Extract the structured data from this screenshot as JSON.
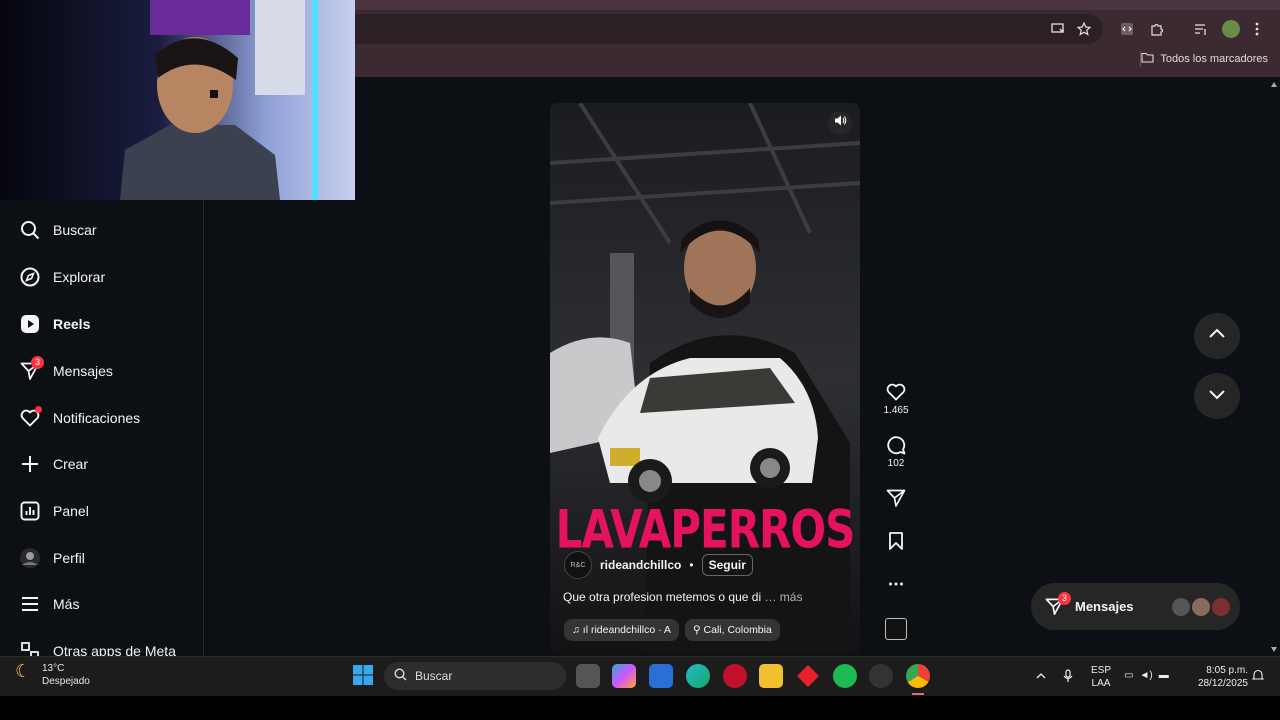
{
  "browser": {
    "bookmarks_label": "Todos los marcadores",
    "icons": [
      "install-icon",
      "star-icon",
      "devtools-icon",
      "extensions-icon",
      "reading-list-icon",
      "profile-icon",
      "menu-icon"
    ]
  },
  "sidebar": {
    "items": [
      {
        "label": "Buscar",
        "icon": "search-icon"
      },
      {
        "label": "Explorar",
        "icon": "compass-icon"
      },
      {
        "label": "Reels",
        "icon": "reels-icon"
      },
      {
        "label": "Mensajes",
        "icon": "send-icon",
        "badge": "3"
      },
      {
        "label": "Notificaciones",
        "icon": "heart-icon"
      },
      {
        "label": "Crear",
        "icon": "plus-icon"
      },
      {
        "label": "Panel",
        "icon": "chart-icon"
      },
      {
        "label": "Perfil",
        "icon": "avatar-icon"
      },
      {
        "label": "Más",
        "icon": "menu-icon"
      },
      {
        "label": "Otras apps de Meta",
        "icon": "meta-apps-icon"
      }
    ]
  },
  "reel": {
    "overlay_title": "LAVAPERROS",
    "author": "rideandchillco",
    "separator": "•",
    "follow_label": "Seguir",
    "caption": "Que otra profesion metemos o que di",
    "caption_more": "… más",
    "audio": "rideandchillco · A",
    "location": "Cali, Colombia",
    "avatar_text": "R&C"
  },
  "actions": {
    "likes": "1.465",
    "comments": "102"
  },
  "messages_pill": {
    "label": "Mensajes",
    "badge": "3"
  },
  "taskbar": {
    "weather_temp": "13°C",
    "weather_desc": "Despejado",
    "search_placeholder": "Buscar",
    "lang_1": "ESP",
    "lang_2": "LAA",
    "time": "8:05 p.m.",
    "date": "28/12/2025"
  },
  "colors": {
    "accent": "#ff3040",
    "overlay_pink": "#e5135f",
    "background": "#0c1014"
  }
}
